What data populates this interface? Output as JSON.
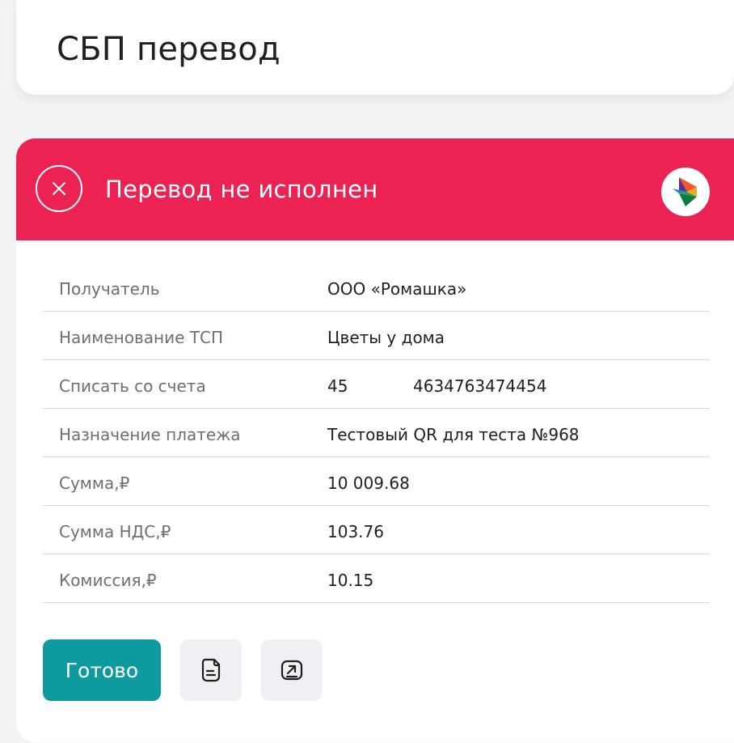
{
  "header": {
    "title": "СБП перевод"
  },
  "status": {
    "text": "Перевод не исполнен",
    "color": "#eb2252",
    "icon": "close-icon",
    "logo": "sbp-logo"
  },
  "details": {
    "rows": [
      {
        "label": "Получатель",
        "value": "ООО «Ромашка»"
      },
      {
        "label": "Наименование ТСП",
        "value": "Цветы у дома"
      },
      {
        "label": "Списать со счета",
        "value": "45",
        "value2": "4634763474454"
      },
      {
        "label": "Назначение платежа",
        "value": "Тестовый QR для теста №968"
      },
      {
        "label": "Сумма,₽",
        "value": "10 009.68"
      },
      {
        "label": "Сумма НДС,₽",
        "value": "103.76"
      },
      {
        "label": "Комиссия,₽",
        "value": "10.15"
      }
    ]
  },
  "actions": {
    "done_label": "Готово",
    "done_color": "#0e9b9f",
    "receipt_icon": "receipt-icon",
    "share_icon": "share-icon"
  }
}
